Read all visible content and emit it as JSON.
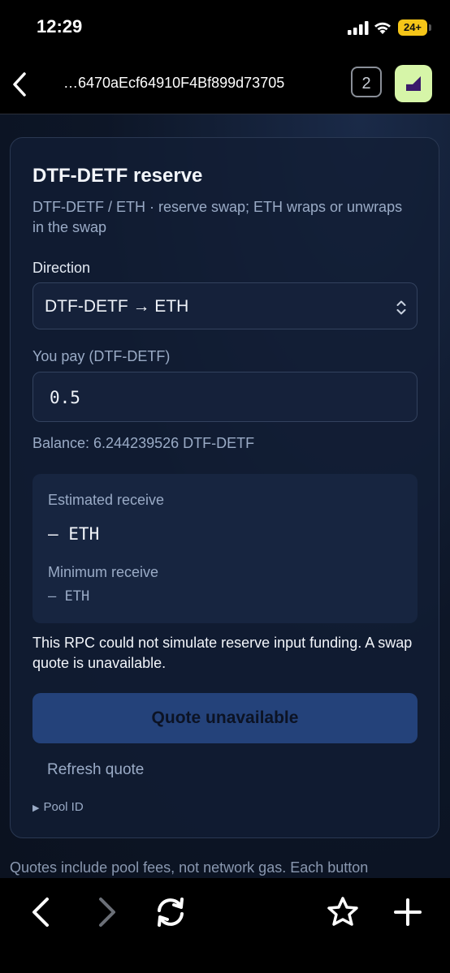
{
  "status_bar": {
    "time": "12:29",
    "battery": "24+"
  },
  "header": {
    "address": "…6470aEcf64910F4Bf899d73705",
    "tab_count": "2"
  },
  "card": {
    "title": "DTF-DETF reserve",
    "subtitle": "DTF-DETF / ETH · reserve swap; ETH wraps or unwraps in the swap",
    "direction_label": "Direction",
    "direction_value": "DTF-DETF → ETH",
    "pay_label": "You pay (DTF-DETF)",
    "pay_value": "0.5",
    "balance": "Balance: 6.244239526 DTF-DETF",
    "estimated_label": "Estimated receive",
    "estimated_value": "— ETH",
    "minimum_label": "Minimum receive",
    "minimum_value": "— ETH",
    "warning": "This RPC could not simulate reserve input funding. A swap quote is unavailable.",
    "quote_button": "Quote unavailable",
    "refresh": "Refresh quote",
    "pool_id": "Pool ID"
  },
  "footer_note": "Quotes include pool fees, not network gas. Each button",
  "toolbar": {
    "icons": [
      "back-icon",
      "forward-icon",
      "reload-icon",
      "star-icon",
      "plus-icon"
    ]
  }
}
